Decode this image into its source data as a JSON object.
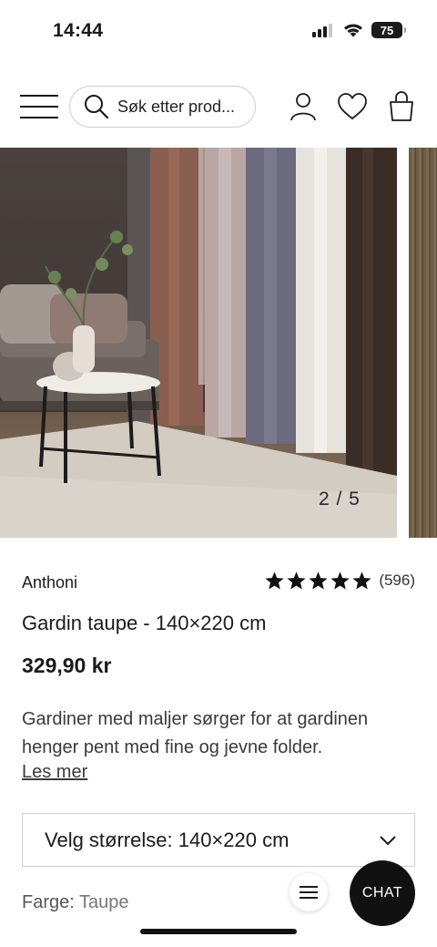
{
  "status_bar": {
    "time": "14:44",
    "battery": "75"
  },
  "header": {
    "search_placeholder": "Søk etter prod..."
  },
  "gallery": {
    "counter": "2 / 5"
  },
  "product": {
    "brand": "Anthoni",
    "rating_stars": 5,
    "rating_count": "(596)",
    "title": "Gardin taupe - 140×220 cm",
    "price": "329,90 kr",
    "description": "Gardiner med maljer sørger for at gardinen henger pent med fine og jevne folder.",
    "read_more": "Les mer",
    "size_select": "Velg størrelse: 140×220 cm",
    "color_label": "Farge:",
    "color_value": "Taupe"
  },
  "floating": {
    "chat_label": "CHAT"
  },
  "colors": {
    "accent": "#111111",
    "star": "#111111",
    "border": "#cfcfcf"
  }
}
